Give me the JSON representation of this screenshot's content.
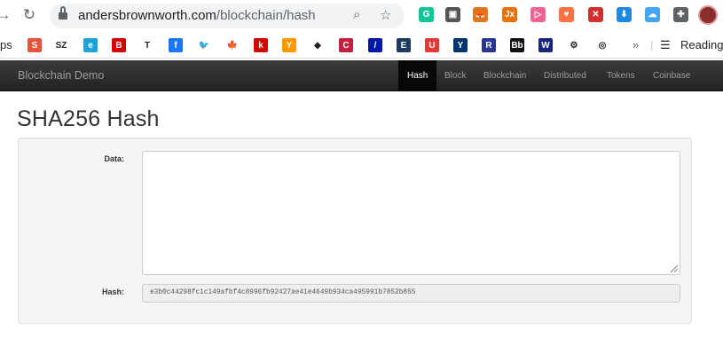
{
  "browser": {
    "url_host": "andersbrownworth.com",
    "url_path": "/blockchain/hash",
    "extensions": [
      {
        "name": "grammarly-icon",
        "color": "#15c39a",
        "glyph": "G"
      },
      {
        "name": "pocket-icon",
        "color": "#555555",
        "glyph": "▣"
      },
      {
        "name": "metamask-icon",
        "color": "#e2761b",
        "glyph": "🦊"
      },
      {
        "name": "jx-icon",
        "color": "#e8710a",
        "glyph": "Jx"
      },
      {
        "name": "video-icon",
        "color": "#f06292",
        "glyph": "▷"
      },
      {
        "name": "heart-icon",
        "color": "#ff7043",
        "glyph": "♥"
      },
      {
        "name": "red-extension-icon",
        "color": "#d32f2f",
        "glyph": "✕"
      },
      {
        "name": "download-icon",
        "color": "#1e88e5",
        "glyph": "⬇"
      },
      {
        "name": "cloud-icon",
        "color": "#42a5f5",
        "glyph": "☁"
      },
      {
        "name": "puzzle-icon",
        "color": "#5f6368",
        "glyph": "✚"
      }
    ],
    "bookmarks_prefix": "ps",
    "bookmarks": [
      {
        "name": "s-bookmark-icon",
        "color": "#e8543a",
        "glyph": "S"
      },
      {
        "name": "sz-bookmark-icon",
        "color": "#ffffff",
        "glyph": "SZ"
      },
      {
        "name": "edge-bookmark-icon",
        "color": "#1fa2d9",
        "glyph": "e"
      },
      {
        "name": "bild-bookmark-icon",
        "color": "#d50000",
        "glyph": "B"
      },
      {
        "name": "nyt-bookmark-icon",
        "color": "#ffffff",
        "glyph": "T"
      },
      {
        "name": "facebook-bookmark-icon",
        "color": "#1877f2",
        "glyph": "f"
      },
      {
        "name": "twitter-bookmark-icon",
        "color": "#ffffff",
        "glyph": "🐦"
      },
      {
        "name": "maple-leaf-bookmark-icon",
        "color": "#ffffff",
        "glyph": "🍁"
      },
      {
        "name": "k-bookmark-icon",
        "color": "#d50000",
        "glyph": "k"
      },
      {
        "name": "filter-bookmark-icon",
        "color": "#ff9800",
        "glyph": "Y"
      },
      {
        "name": "hsbc-bookmark-icon",
        "color": "#ffffff",
        "glyph": "◆"
      },
      {
        "name": "cibc-bookmark-icon",
        "color": "#c41f3e",
        "glyph": "C"
      },
      {
        "name": "deutsche-bank-bookmark-icon",
        "color": "#0018a8",
        "glyph": "/"
      },
      {
        "name": "economist-bookmark-icon",
        "color": "#1e3a5f",
        "glyph": "E"
      },
      {
        "name": "u-bookmark-icon",
        "color": "#e53935",
        "glyph": "U"
      },
      {
        "name": "yale-bookmark-icon",
        "color": "#00356b",
        "glyph": "Y"
      },
      {
        "name": "r-bookmark-icon",
        "color": "#283593",
        "glyph": "R"
      },
      {
        "name": "bb-bookmark-icon",
        "color": "#111111",
        "glyph": "Bb"
      },
      {
        "name": "w-bookmark-icon",
        "color": "#1a237e",
        "glyph": "W"
      },
      {
        "name": "gear-bookmark-icon",
        "color": "#ffffff",
        "glyph": "⚙"
      },
      {
        "name": "target-bookmark-icon",
        "color": "#ffffff",
        "glyph": "◎"
      }
    ],
    "more_bookmarks": "»",
    "reading_list": "Reading"
  },
  "navbar": {
    "brand": "Blockchain Demo",
    "items": [
      {
        "label": "Hash",
        "active": true
      },
      {
        "label": "Block",
        "active": false
      },
      {
        "label": "Blockchain",
        "active": false
      },
      {
        "label": "Distributed",
        "active": false
      },
      {
        "label": "Tokens",
        "active": false
      },
      {
        "label": "Coinbase",
        "active": false
      }
    ]
  },
  "page": {
    "title": "SHA256 Hash",
    "data_label": "Data:",
    "data_value": "",
    "hash_label": "Hash:",
    "hash_value": "e3b0c44298fc1c149afbf4c8996fb92427ae41e4649b934ca495991b7852b855"
  },
  "colors": {
    "navbar_bg": "#222222",
    "navbar_active": "#080808",
    "well_bg": "#f5f5f5"
  }
}
